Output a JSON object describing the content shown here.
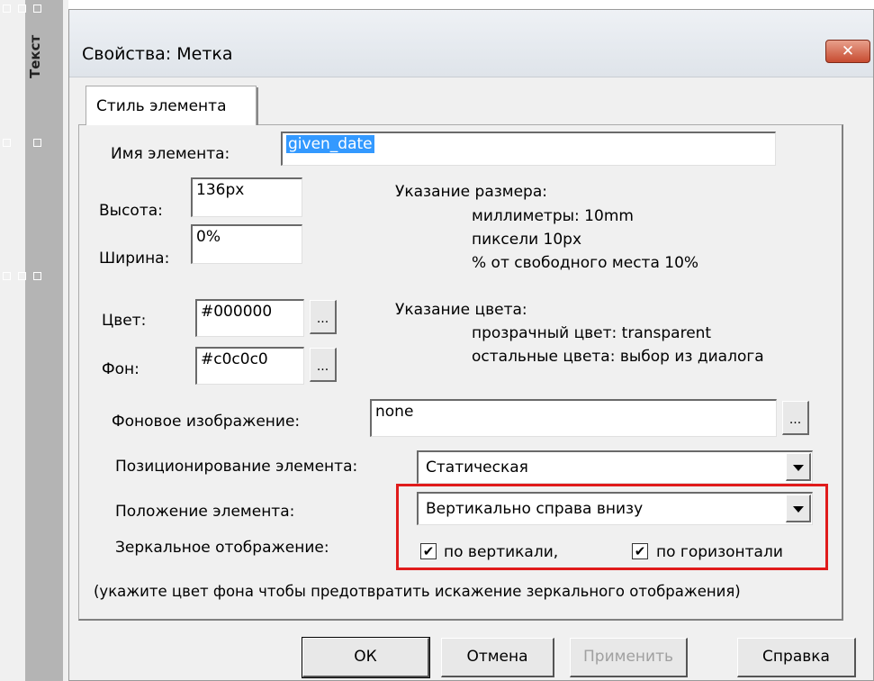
{
  "background": {
    "panel_label": "Текст"
  },
  "dialog": {
    "title": "Свойства: Метка",
    "close_glyph": "✕",
    "tab_label": "Стиль элемента"
  },
  "form": {
    "name_label": "Имя элемента:",
    "name_value": "given_date",
    "height_label": "Высота:",
    "height_value": "136px",
    "width_label": "Ширина:",
    "width_value": "0%",
    "size_hint_title": "Указание размера:",
    "size_hint_mm": "миллиметры: 10mm",
    "size_hint_px": "пиксели 10px",
    "size_hint_pct": "% от свободного места 10%",
    "color_label": "Цвет:",
    "color_value": "#000000",
    "bg_label": "Фон:",
    "bg_value": "#c0c0c0",
    "dots": "...",
    "color_hint_title": "Указание цвета:",
    "color_hint_transparent": "прозрачный цвет: transparent",
    "color_hint_other": "остальные цвета: выбор из диалога",
    "bgimage_label": "Фоновое изображение:",
    "bgimage_value": "none",
    "positioning_label": "Позиционирование элемента:",
    "positioning_value": "Статическая",
    "placement_label": "Положение элемента:",
    "placement_value": "Вертикально справа внизу",
    "mirror_label": "Зеркальное отображение:",
    "mirror_vertical_label": "по вертикали,",
    "mirror_vertical_checked": true,
    "mirror_horizontal_label": "по горизонтали",
    "mirror_horizontal_checked": true,
    "check_glyph": "✔",
    "mirror_note": "(укажите цвет фона чтобы предотвратить искажение зеркального отображения)"
  },
  "buttons": {
    "ok": "ОК",
    "cancel": "Отмена",
    "apply": "Применить",
    "help": "Справка"
  },
  "colors": {
    "highlight": "#e01b1b",
    "selection": "#3399ff"
  }
}
